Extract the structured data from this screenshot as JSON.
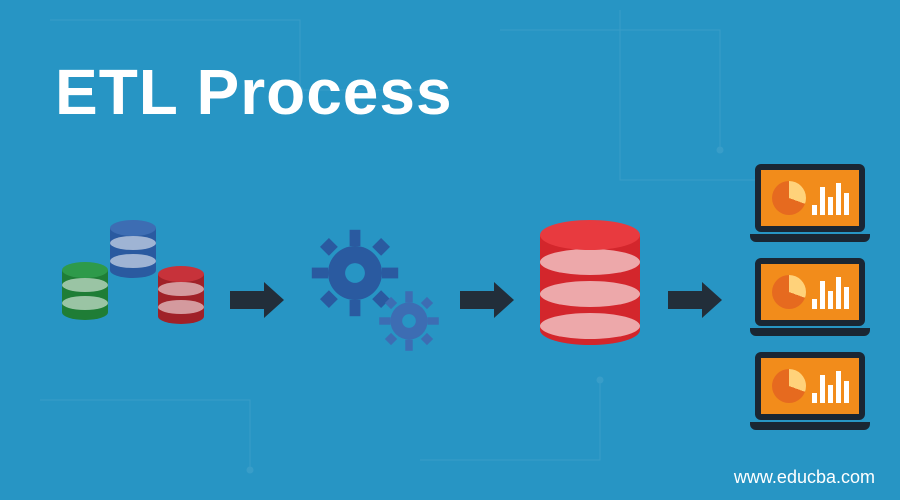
{
  "title": "ETL Process",
  "website": "www.educba.com",
  "diagram": {
    "extract_sources": [
      {
        "color": "blue"
      },
      {
        "color": "green"
      },
      {
        "color": "red"
      }
    ],
    "transform": {
      "gears": 2,
      "gear_colors": [
        "#2a5aa0",
        "#3d6db3"
      ]
    },
    "load_target": {
      "shape": "database",
      "color": "red"
    },
    "outputs": {
      "count": 3,
      "device": "laptop",
      "screen_color": "#f28c1b",
      "visuals": [
        "pie-chart",
        "bar-chart"
      ]
    }
  },
  "colors": {
    "background": "#2795c4",
    "title_text": "#ffffff",
    "arrow": "#222e3a"
  }
}
